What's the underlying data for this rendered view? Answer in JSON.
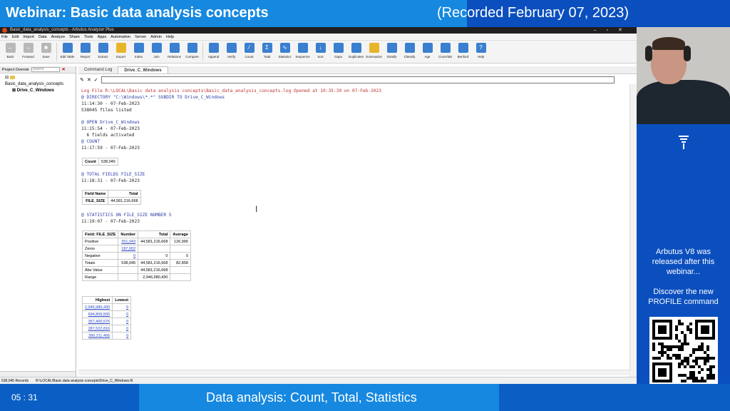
{
  "banner": {
    "title": "Webinar: Basic data analysis concepts",
    "recorded": "(Recorded February 07, 2023)"
  },
  "window": {
    "title": "Basic_data_analysis_concepts - Arbutus Analyzer Plus"
  },
  "menu": [
    "File",
    "Edit",
    "Import",
    "Data",
    "Analyze",
    "Share",
    "Tools",
    "Apps",
    "Automation",
    "Server",
    "Admin",
    "Help"
  ],
  "toolbar": [
    {
      "label": "Back",
      "icon": "back-arrow-icon"
    },
    {
      "label": "Forward",
      "icon": "forward-arrow-icon"
    },
    {
      "label": "Save",
      "icon": "save-icon"
    },
    {
      "label": "Edit Table",
      "icon": "edit-table-icon"
    },
    {
      "label": "Report",
      "icon": "report-icon"
    },
    {
      "label": "Extract",
      "icon": "extract-icon"
    },
    {
      "label": "Export",
      "icon": "export-icon"
    },
    {
      "label": "Index",
      "icon": "index-icon"
    },
    {
      "label": "Join",
      "icon": "join-icon"
    },
    {
      "label": "Relations",
      "icon": "relations-icon"
    },
    {
      "label": "Compare",
      "icon": "compare-icon"
    },
    {
      "label": "Append",
      "icon": "append-icon"
    },
    {
      "label": "Verify",
      "icon": "verify-icon"
    },
    {
      "label": "Count",
      "icon": "count-icon"
    },
    {
      "label": "Total",
      "icon": "total-icon"
    },
    {
      "label": "Statistics",
      "icon": "statistics-icon"
    },
    {
      "label": "Sequence",
      "icon": "sequence-icon"
    },
    {
      "label": "Sort",
      "icon": "sort-icon"
    },
    {
      "label": "Gaps",
      "icon": "gaps-icon"
    },
    {
      "label": "Duplicates",
      "icon": "duplicates-icon"
    },
    {
      "label": "Summarize",
      "icon": "summarize-icon"
    },
    {
      "label": "Stratify",
      "icon": "stratify-icon"
    },
    {
      "label": "Classify",
      "icon": "classify-icon"
    },
    {
      "label": "Age",
      "icon": "age-icon"
    },
    {
      "label": "CrossTab",
      "icon": "crosstab-icon"
    },
    {
      "label": "Benford",
      "icon": "benford-icon"
    },
    {
      "label": "Help",
      "icon": "help-icon"
    }
  ],
  "project": {
    "label": "Project Overvie",
    "search_placeholder": "Search",
    "root": "Basic_data_analysis_concepts",
    "table": "Drive_C_Windows"
  },
  "tabs": {
    "command_log": "Command Log",
    "table": "Drive_C_Windows"
  },
  "log": {
    "l1": "Log File R:\\LOCAL\\Basic data analysis concepts\\Basic_data_analysis_concepts.log Opened at 10:35:39 on 07-Feb-2023",
    "l2": "@ DIRECTORY \"C:\\Windows\\*.*\" SUBDIR TO Drive_C_Windows",
    "l3": "11:14:30 - 07-Feb-2023",
    "l4": "538045 files listed",
    "l5": "@ OPEN Drive_C_Windows",
    "l6": "11:15:54 - 07-Feb-2023",
    "l7": "  6 fields activated",
    "l8": "@ COUNT",
    "l9": "11:17:59 - 07-Feb-2023",
    "l10": "@ TOTAL FIELDS FILE_SIZE",
    "l11": "11:18:31 - 07-Feb-2023",
    "l12": "@ STATISTICS ON FILE_SIZE NUMBER 5",
    "l13": "11:19:07 - 07-Feb-2023"
  },
  "count": {
    "label": "Count",
    "value": "538,045"
  },
  "total": {
    "h_field": "Field Name",
    "h_total": "Total",
    "field": "FILE_SIZE",
    "value": "44,581,216,668"
  },
  "stats": {
    "h": [
      "Field: FILE_SIZE",
      "Number",
      "Total",
      "Average"
    ],
    "rows": [
      {
        "name": "Positive",
        "number": "351,043",
        "total": "44,581,216,668",
        "avg": "126,996"
      },
      {
        "name": "Zeros",
        "number": "187,002",
        "total": "",
        "avg": ""
      },
      {
        "name": "Negative",
        "number": "0",
        "total": "0",
        "avg": "0"
      },
      {
        "name": "Totals",
        "number": "538,045",
        "total": "44,581,216,668",
        "avg": "82,858"
      },
      {
        "name": "Abs Value",
        "number": "",
        "total": "44,581,216,668",
        "avg": ""
      },
      {
        "name": "Range",
        "number": "",
        "total": "2,946,980,430",
        "avg": ""
      }
    ]
  },
  "hl": {
    "h_high": "Highest",
    "h_low": "Lowest",
    "rows": [
      {
        "high": "2,946,980,430",
        "low": "0"
      },
      {
        "high": "694,809,505",
        "low": "0"
      },
      {
        "high": "357,400,576",
        "low": "0"
      },
      {
        "high": "287,522,816",
        "low": "0"
      },
      {
        "high": "280,211,456",
        "low": "0"
      }
    ]
  },
  "status": {
    "records": "538,045 Records",
    "path": "R:\\LOCAL\\Basic data analysis concepts\\Drive_C_Windows.fil"
  },
  "side": {
    "msg1": "Arbutus V8 was released after this webinar...",
    "msg2": "Discover the new PROFILE command"
  },
  "footer": {
    "time": "05 : 31",
    "subtitle": "Data analysis: Count, Total, Statistics"
  }
}
